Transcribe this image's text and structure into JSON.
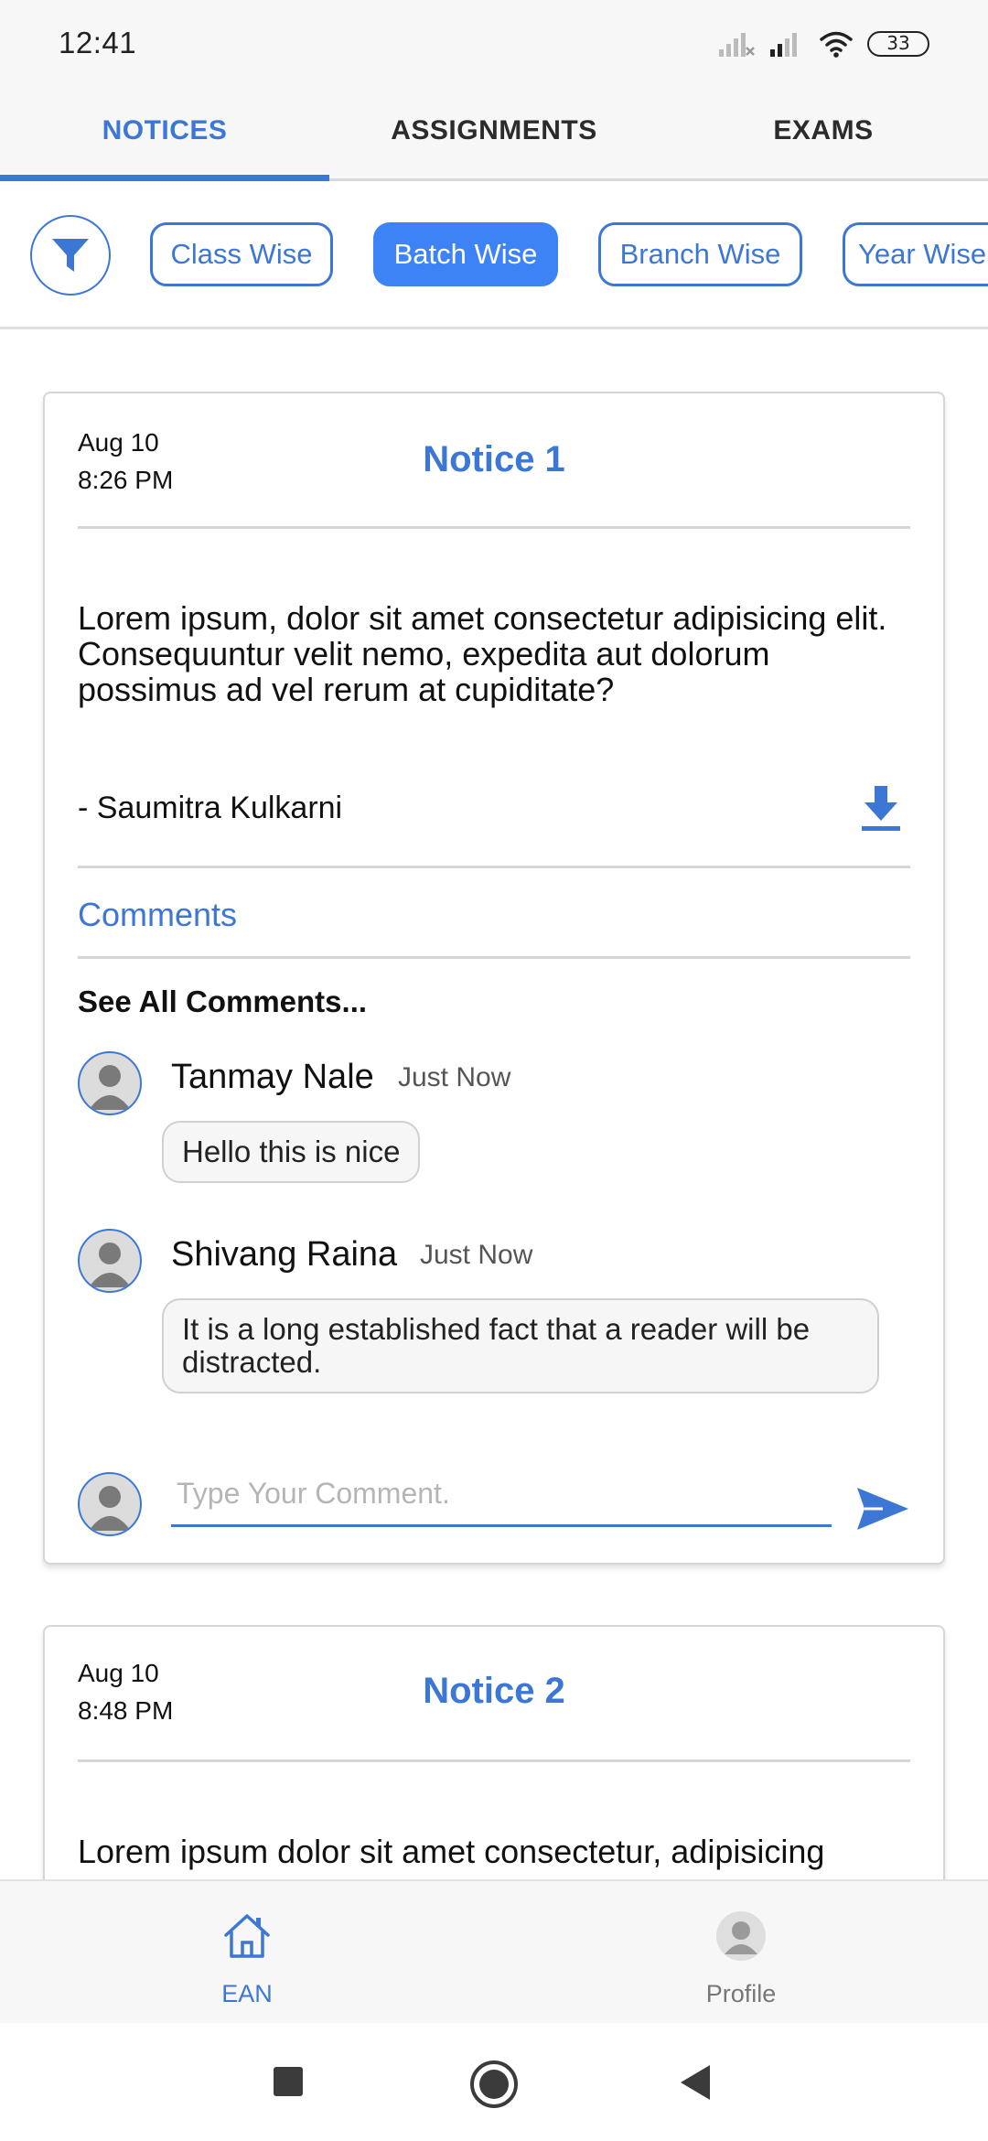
{
  "status_bar": {
    "time": "12:41",
    "battery": "33"
  },
  "tabs": [
    {
      "label": "NOTICES"
    },
    {
      "label": "ASSIGNMENTS"
    },
    {
      "label": "EXAMS"
    }
  ],
  "filters": {
    "chips": [
      {
        "label": "Class Wise"
      },
      {
        "label": "Batch Wise"
      },
      {
        "label": "Branch Wise"
      },
      {
        "label": "Year Wise"
      }
    ],
    "active": "Batch Wise"
  },
  "notices": [
    {
      "date": "Aug 10",
      "time": "8:26 PM",
      "title": "Notice 1",
      "body": "Lorem ipsum, dolor sit amet consectetur adipisicing elit. Consequuntur velit nemo, expedita aut dolorum possimus ad vel rerum at cupiditate?",
      "author": "- Saumitra Kulkarni",
      "comments_label": "Comments",
      "see_all": "See All Comments...",
      "comments": [
        {
          "name": "Tanmay Nale",
          "time": "Just Now",
          "text": "Hello this is nice"
        },
        {
          "name": "Shivang Raina",
          "time": "Just Now",
          "text": "It is a long established fact that a reader will be distracted."
        }
      ],
      "comment_placeholder": "Type Your Comment."
    },
    {
      "date": "Aug 10",
      "time": "8:48 PM",
      "title": "Notice 2",
      "body": "Lorem ipsum dolor sit amet consectetur, adipisicing"
    }
  ],
  "bottom_nav": [
    {
      "label": "EAN",
      "icon": "home-icon",
      "active": true
    },
    {
      "label": "Profile",
      "icon": "profile-icon",
      "active": false
    }
  ],
  "colors": {
    "accent": "#3d77d6",
    "chip_active": "#3d83f5"
  }
}
